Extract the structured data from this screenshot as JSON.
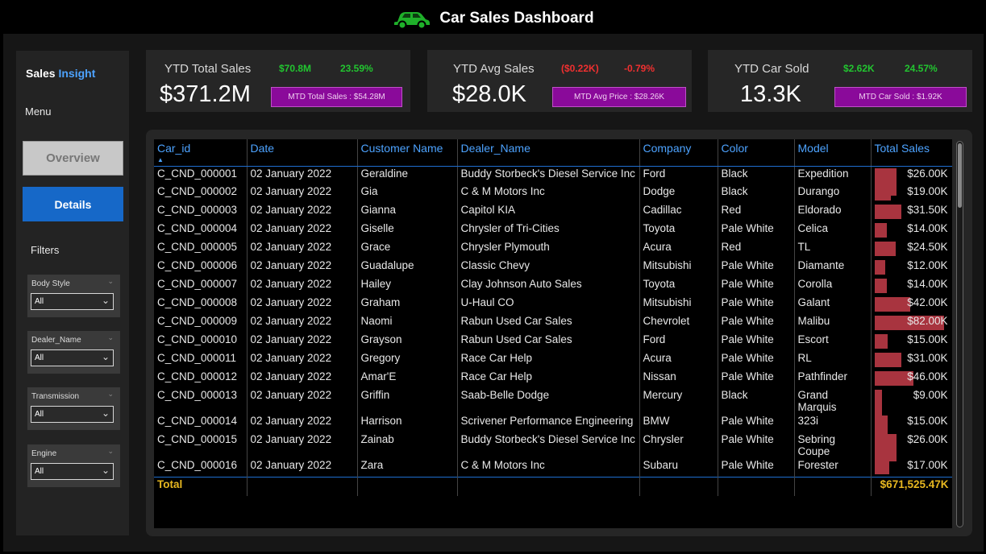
{
  "header": {
    "title": "Car Sales Dashboard",
    "icon": "car-icon"
  },
  "sidebar": {
    "brand_part1": "Sales",
    "brand_part2": "Insight",
    "menu_label": "Menu",
    "overview_label": "Overview",
    "details_label": "Details",
    "filters_label": "Filters",
    "slicers": [
      {
        "title": "Body Style",
        "value": "All"
      },
      {
        "title": "Dealer_Name",
        "value": "All"
      },
      {
        "title": "Transmission",
        "value": "All"
      },
      {
        "title": "Engine",
        "value": "All"
      }
    ]
  },
  "kpis": [
    {
      "label": "YTD Total Sales",
      "value": "$371.2M",
      "delta1": "$70.8M",
      "delta2": "23.59%",
      "mtd": "MTD Total Sales : $54.28M",
      "trend": "up"
    },
    {
      "label": "YTD Avg Sales",
      "value": "$28.0K",
      "delta1": "($0.22K)",
      "delta2": "-0.79%",
      "mtd": "MTD Avg Price : $28.26K",
      "trend": "down"
    },
    {
      "label": "YTD Car Sold",
      "value": "13.3K",
      "delta1": "$2.62K",
      "delta2": "24.57%",
      "mtd": "MTD Car Sold : $1.92K",
      "trend": "up"
    }
  ],
  "colors": {
    "up": "#22c530",
    "down": "#f03030",
    "bar": "#a8343f",
    "accent": "#4da3ff",
    "mtd": "#8a0a9a",
    "total": "#e8b820"
  },
  "table": {
    "columns": [
      "Car_id",
      "Date",
      "Customer Name",
      "Dealer_Name",
      "Company",
      "Color",
      "Model",
      "Total Sales"
    ],
    "rows": [
      {
        "car_id": "C_CND_000001",
        "date": "02 January 2022",
        "customer": "Geraldine",
        "dealer": "Buddy Storbeck's Diesel Service Inc",
        "company": "Ford",
        "color": "Black",
        "model": "Expedition",
        "sales": "$26.00K",
        "amount": 26000
      },
      {
        "car_id": "C_CND_000002",
        "date": "02 January 2022",
        "customer": "Gia",
        "dealer": "C & M Motors Inc",
        "company": "Dodge",
        "color": "Black",
        "model": "Durango",
        "sales": "$19.00K",
        "amount": 19000
      },
      {
        "car_id": "C_CND_000003",
        "date": "02 January 2022",
        "customer": "Gianna",
        "dealer": "Capitol KIA",
        "company": "Cadillac",
        "color": "Red",
        "model": "Eldorado",
        "sales": "$31.50K",
        "amount": 31500
      },
      {
        "car_id": "C_CND_000004",
        "date": "02 January 2022",
        "customer": "Giselle",
        "dealer": "Chrysler of Tri-Cities",
        "company": "Toyota",
        "color": "Pale White",
        "model": "Celica",
        "sales": "$14.00K",
        "amount": 14000
      },
      {
        "car_id": "C_CND_000005",
        "date": "02 January 2022",
        "customer": "Grace",
        "dealer": "Chrysler Plymouth",
        "company": "Acura",
        "color": "Red",
        "model": "TL",
        "sales": "$24.50K",
        "amount": 24500
      },
      {
        "car_id": "C_CND_000006",
        "date": "02 January 2022",
        "customer": "Guadalupe",
        "dealer": "Classic Chevy",
        "company": "Mitsubishi",
        "color": "Pale White",
        "model": "Diamante",
        "sales": "$12.00K",
        "amount": 12000
      },
      {
        "car_id": "C_CND_000007",
        "date": "02 January 2022",
        "customer": "Hailey",
        "dealer": "Clay Johnson Auto Sales",
        "company": "Toyota",
        "color": "Pale White",
        "model": "Corolla",
        "sales": "$14.00K",
        "amount": 14000
      },
      {
        "car_id": "C_CND_000008",
        "date": "02 January 2022",
        "customer": "Graham",
        "dealer": "U-Haul CO",
        "company": "Mitsubishi",
        "color": "Pale White",
        "model": "Galant",
        "sales": "$42.00K",
        "amount": 42000
      },
      {
        "car_id": "C_CND_000009",
        "date": "02 January 2022",
        "customer": "Naomi",
        "dealer": "Rabun Used Car Sales",
        "company": "Chevrolet",
        "color": "Pale White",
        "model": "Malibu",
        "sales": "$82.00K",
        "amount": 82000
      },
      {
        "car_id": "C_CND_000010",
        "date": "02 January 2022",
        "customer": "Grayson",
        "dealer": "Rabun Used Car Sales",
        "company": "Ford",
        "color": "Pale White",
        "model": "Escort",
        "sales": "$15.00K",
        "amount": 15000
      },
      {
        "car_id": "C_CND_000011",
        "date": "02 January 2022",
        "customer": "Gregory",
        "dealer": "Race Car Help",
        "company": "Acura",
        "color": "Pale White",
        "model": "RL",
        "sales": "$31.00K",
        "amount": 31000
      },
      {
        "car_id": "C_CND_000012",
        "date": "02 January 2022",
        "customer": "Amar'E",
        "dealer": "Race Car Help",
        "company": "Nissan",
        "color": "Pale White",
        "model": "Pathfinder",
        "sales": "$46.00K",
        "amount": 46000
      },
      {
        "car_id": "C_CND_000013",
        "date": "02 January 2022",
        "customer": "Griffin",
        "dealer": "Saab-Belle Dodge",
        "company": "Mercury",
        "color": "Black",
        "model": "Grand Marquis",
        "sales": "$9.00K",
        "amount": 9000
      },
      {
        "car_id": "C_CND_000014",
        "date": "02 January 2022",
        "customer": "Harrison",
        "dealer": "Scrivener Performance Engineering",
        "company": "BMW",
        "color": "Pale White",
        "model": "323i",
        "sales": "$15.00K",
        "amount": 15000
      },
      {
        "car_id": "C_CND_000015",
        "date": "02 January 2022",
        "customer": "Zainab",
        "dealer": "Buddy Storbeck's Diesel Service Inc",
        "company": "Chrysler",
        "color": "Pale White",
        "model": "Sebring Coupe",
        "sales": "$26.00K",
        "amount": 26000
      },
      {
        "car_id": "C_CND_000016",
        "date": "02 January 2022",
        "customer": "Zara",
        "dealer": "C & M Motors Inc",
        "company": "Subaru",
        "color": "Pale White",
        "model": "Forester",
        "sales": "$17.00K",
        "amount": 17000
      }
    ],
    "total_label": "Total",
    "total_value": "$671,525.47K"
  }
}
